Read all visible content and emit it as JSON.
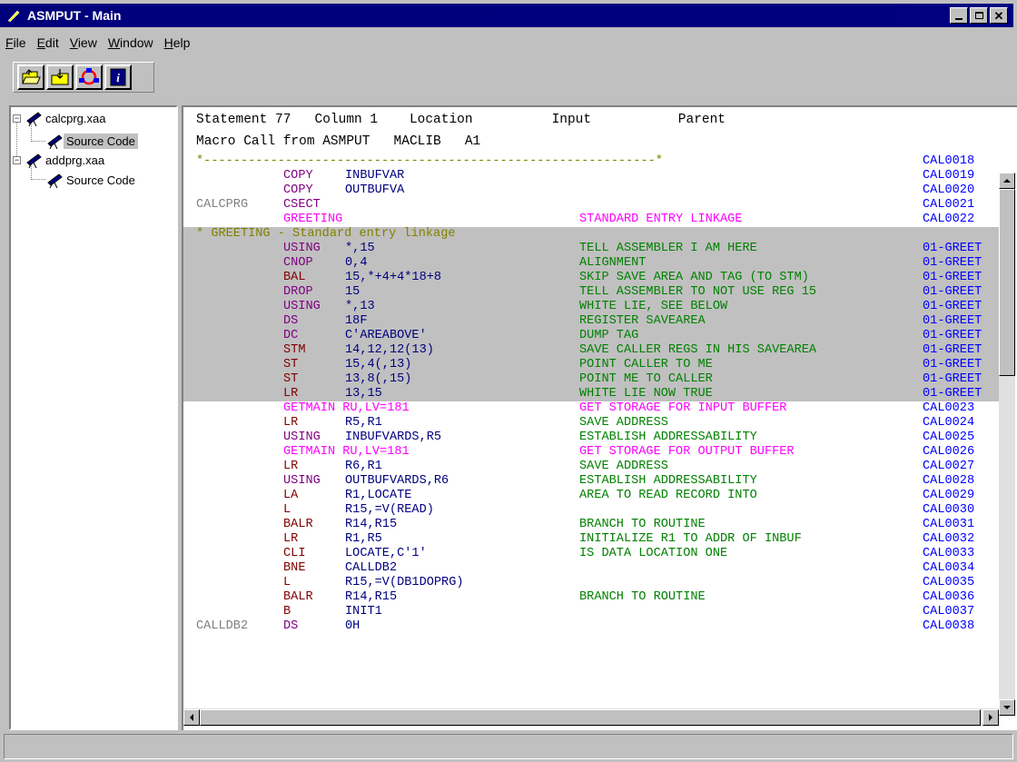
{
  "window": {
    "title": "ASMPUT - Main"
  },
  "menu": [
    {
      "label": "File",
      "ul": "F",
      "rest": "ile"
    },
    {
      "label": "Edit",
      "ul": "E",
      "rest": "dit"
    },
    {
      "label": "View",
      "ul": "V",
      "rest": "iew"
    },
    {
      "label": "Window",
      "ul": "W",
      "rest": "indow"
    },
    {
      "label": "Help",
      "ul": "H",
      "rest": "elp"
    }
  ],
  "toolbar": {
    "buttons": [
      {
        "name": "open-folder-icon"
      },
      {
        "name": "import-folder-icon"
      },
      {
        "name": "refresh-cycle-icon"
      },
      {
        "name": "info-icon"
      }
    ]
  },
  "tree": {
    "items": [
      {
        "label": "calcprg.xaa",
        "children": [
          {
            "label": "Source Code",
            "selected": true
          }
        ]
      },
      {
        "label": "addprg.xaa",
        "children": [
          {
            "label": "Source Code",
            "selected": false
          }
        ]
      }
    ]
  },
  "header": {
    "line1": "Statement 77   Column 1    Location          Input           Parent",
    "line2": "Macro Call from ASMPUT   MACLIB   A1"
  },
  "colors": {
    "opcode_red": "#800000",
    "opcode_purple": "#800080",
    "operand_blue": "#000080",
    "macro_magenta": "#ff00ff",
    "comment_green": "#008000",
    "sequence_blue": "#0000ff",
    "label_gray": "#808080",
    "shade_gray": "#c0c0c0",
    "olive": "#808000"
  },
  "code": [
    {
      "label": "",
      "op": "",
      "arg": "",
      "cmt": "",
      "seq": "CAL0018",
      "full": "*-------------------------------------------------------------*",
      "fullColor": "#808000",
      "shaded": false
    },
    {
      "label": "",
      "op": "COPY",
      "opc": "#800080",
      "arg": "INBUFVAR",
      "argc": "#000080",
      "cmt": "",
      "seq": "CAL0019",
      "shaded": false
    },
    {
      "label": "",
      "op": "COPY",
      "opc": "#800080",
      "arg": "OUTBUFVA",
      "argc": "#000080",
      "cmt": "",
      "seq": "CAL0020",
      "shaded": false
    },
    {
      "label": "CALCPRG",
      "op": "CSECT",
      "opc": "#800080",
      "arg": "",
      "cmt": "",
      "seq": "CAL0021",
      "shaded": false
    },
    {
      "label": "",
      "op": "GREETING",
      "opc": "#ff00ff",
      "arg": "",
      "cmt": "STANDARD ENTRY LINKAGE",
      "cmtc": "#ff00ff",
      "seq": "CAL0022",
      "shaded": false
    },
    {
      "label": "",
      "op": "",
      "arg": "",
      "cmt": "",
      "seq": "",
      "full": "* GREETING - Standard entry linkage",
      "fullColor": "#808000",
      "shaded": true
    },
    {
      "label": "",
      "op": "USING",
      "opc": "#800080",
      "arg": "*,15",
      "argc": "#000080",
      "cmt": "TELL ASSEMBLER I AM HERE",
      "seq": "01-GREET",
      "shaded": true
    },
    {
      "label": "",
      "op": "CNOP",
      "opc": "#800080",
      "arg": "0,4",
      "argc": "#000080",
      "cmt": "ALIGNMENT",
      "seq": "01-GREET",
      "shaded": true
    },
    {
      "label": "",
      "op": "BAL",
      "opc": "#800000",
      "arg": "15,*+4+4*18+8",
      "argc": "#000080",
      "cmt": "SKIP SAVE AREA AND TAG (TO STM)",
      "seq": "01-GREET",
      "shaded": true
    },
    {
      "label": "",
      "op": "DROP",
      "opc": "#800080",
      "arg": "15",
      "argc": "#000080",
      "cmt": "TELL ASSEMBLER TO NOT USE REG 15",
      "seq": "01-GREET",
      "shaded": true
    },
    {
      "label": "",
      "op": "USING",
      "opc": "#800080",
      "arg": "*,13",
      "argc": "#000080",
      "cmt": "WHITE LIE, SEE BELOW",
      "seq": "01-GREET",
      "shaded": true
    },
    {
      "label": "",
      "op": "DS",
      "opc": "#800080",
      "arg": "18F",
      "argc": "#000080",
      "cmt": "REGISTER SAVEAREA",
      "seq": "01-GREET",
      "shaded": true
    },
    {
      "label": "",
      "op": "DC",
      "opc": "#800080",
      "arg": "C'AREABOVE'",
      "argc": "#000080",
      "cmt": "DUMP TAG",
      "seq": "01-GREET",
      "shaded": true
    },
    {
      "label": "",
      "op": "STM",
      "opc": "#800000",
      "arg": "14,12,12(13)",
      "argc": "#000080",
      "cmt": "SAVE CALLER REGS IN HIS SAVEAREA",
      "seq": "01-GREET",
      "shaded": true
    },
    {
      "label": "",
      "op": "ST",
      "opc": "#800000",
      "arg": "15,4(,13)",
      "argc": "#000080",
      "cmt": "POINT CALLER TO ME",
      "seq": "01-GREET",
      "shaded": true
    },
    {
      "label": "",
      "op": "ST",
      "opc": "#800000",
      "arg": "13,8(,15)",
      "argc": "#000080",
      "cmt": "POINT ME TO CALLER",
      "seq": "01-GREET",
      "shaded": true
    },
    {
      "label": "",
      "op": "LR",
      "opc": "#800000",
      "arg": "13,15",
      "argc": "#000080",
      "cmt": "WHITE LIE NOW TRUE",
      "seq": "01-GREET",
      "shaded": true
    },
    {
      "label": "",
      "op": "GETMAIN RU,LV=181",
      "opc": "#ff00ff",
      "arg": "",
      "cmt": "GET STORAGE FOR INPUT BUFFER",
      "cmtc": "#ff00ff",
      "seq": "CAL0023",
      "shaded": false
    },
    {
      "label": "",
      "op": "LR",
      "opc": "#800000",
      "arg": "R5,R1",
      "argc": "#000080",
      "cmt": "SAVE ADDRESS",
      "seq": "CAL0024",
      "shaded": false
    },
    {
      "label": "",
      "op": "USING",
      "opc": "#800080",
      "arg": "INBUFVARDS,R5",
      "argc": "#000080",
      "cmt": "ESTABLISH ADDRESSABILITY",
      "seq": "CAL0025",
      "shaded": false
    },
    {
      "label": "",
      "op": "GETMAIN RU,LV=181",
      "opc": "#ff00ff",
      "arg": "",
      "cmt": "GET STORAGE FOR OUTPUT BUFFER",
      "cmtc": "#ff00ff",
      "seq": "CAL0026",
      "shaded": false
    },
    {
      "label": "",
      "op": "LR",
      "opc": "#800000",
      "arg": "R6,R1",
      "argc": "#000080",
      "cmt": "SAVE ADDRESS",
      "seq": "CAL0027",
      "shaded": false
    },
    {
      "label": "",
      "op": "USING",
      "opc": "#800080",
      "arg": "OUTBUFVARDS,R6",
      "argc": "#000080",
      "cmt": "ESTABLISH ADDRESSABILITY",
      "seq": "CAL0028",
      "shaded": false
    },
    {
      "label": "",
      "op": "LA",
      "opc": "#800000",
      "arg": "R1,LOCATE",
      "argc": "#000080",
      "cmt": "AREA TO READ RECORD INTO",
      "seq": "CAL0029",
      "shaded": false
    },
    {
      "label": "",
      "op": "L",
      "opc": "#800000",
      "arg": "R15,=V(READ)",
      "argc": "#000080",
      "cmt": "",
      "seq": "CAL0030",
      "shaded": false
    },
    {
      "label": "",
      "op": "BALR",
      "opc": "#800000",
      "arg": "R14,R15",
      "argc": "#000080",
      "cmt": "BRANCH TO ROUTINE",
      "seq": "CAL0031",
      "shaded": false
    },
    {
      "label": "",
      "op": "LR",
      "opc": "#800000",
      "arg": "R1,R5",
      "argc": "#000080",
      "cmt": "INITIALIZE R1 TO ADDR OF INBUF",
      "seq": "CAL0032",
      "shaded": false
    },
    {
      "label": "",
      "op": "CLI",
      "opc": "#800000",
      "arg": "LOCATE,C'1'",
      "argc": "#000080",
      "cmt": "IS DATA LOCATION ONE",
      "seq": "CAL0033",
      "shaded": false
    },
    {
      "label": "",
      "op": "BNE",
      "opc": "#800000",
      "arg": "CALLDB2",
      "argc": "#000080",
      "cmt": "",
      "seq": "CAL0034",
      "shaded": false
    },
    {
      "label": "",
      "op": "L",
      "opc": "#800000",
      "arg": "R15,=V(DB1DOPRG)",
      "argc": "#000080",
      "cmt": "",
      "seq": "CAL0035",
      "shaded": false
    },
    {
      "label": "",
      "op": "BALR",
      "opc": "#800000",
      "arg": "R14,R15",
      "argc": "#000080",
      "cmt": "BRANCH TO ROUTINE",
      "seq": "CAL0036",
      "shaded": false
    },
    {
      "label": "",
      "op": "B",
      "opc": "#800000",
      "arg": "INIT1",
      "argc": "#000080",
      "cmt": "",
      "seq": "CAL0037",
      "shaded": false
    },
    {
      "label": "CALLDB2",
      "op": "DS",
      "opc": "#800080",
      "arg": "0H",
      "argc": "#000080",
      "cmt": "",
      "seq": "CAL0038",
      "shaded": false
    }
  ]
}
